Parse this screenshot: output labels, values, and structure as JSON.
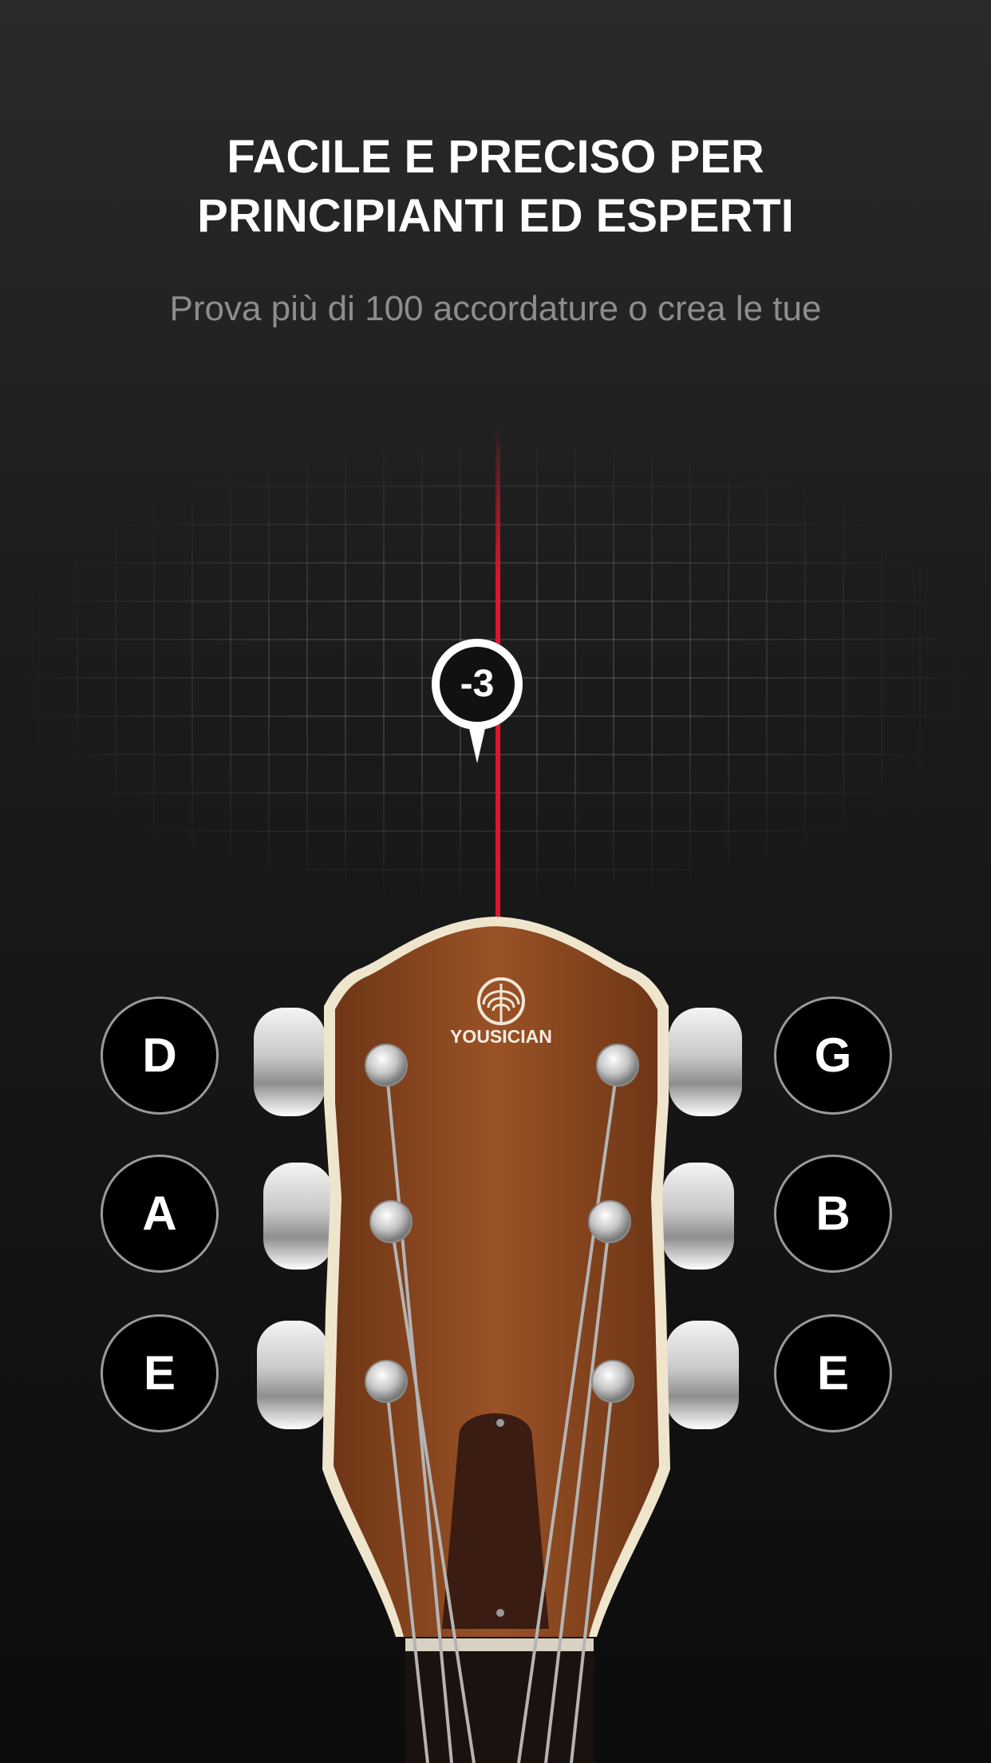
{
  "headline": {
    "line1": "FACILE E PRECISO PER",
    "line2": "PRINCIPIANTI ED ESPERTI"
  },
  "subtitle": "Prova più di 100 accordature o crea le tue",
  "tuner": {
    "cents_offset": "-3",
    "needle_color": "#e0142a"
  },
  "strings": {
    "left": [
      "D",
      "A",
      "E"
    ],
    "right": [
      "G",
      "B",
      "E"
    ]
  },
  "brand": {
    "logo_text": "YOUSICIAN"
  },
  "colors": {
    "background": "#1c1c1c",
    "headstock_wood": "#8a4420",
    "headstock_binding": "#efe5cc",
    "button_border": "#9a9a9a"
  }
}
